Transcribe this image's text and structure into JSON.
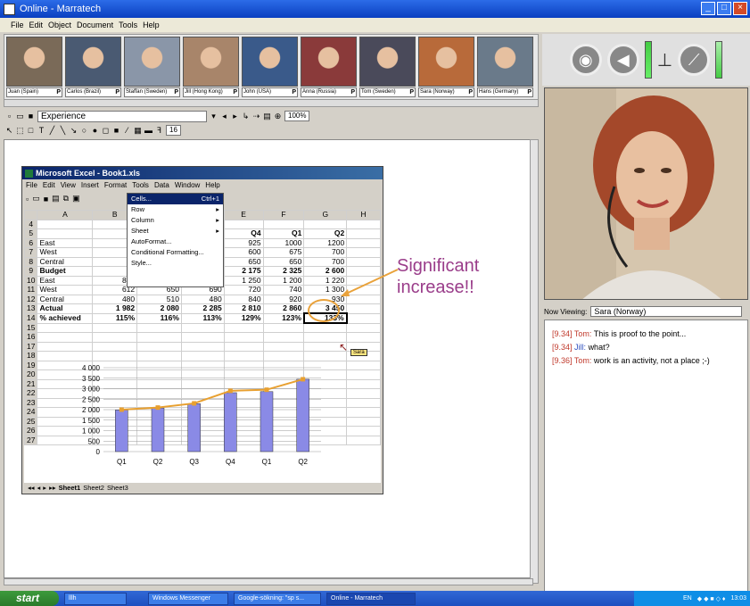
{
  "app": {
    "title": "Online - Marratech"
  },
  "menu": [
    "File",
    "Edit",
    "Object",
    "Document",
    "Tools",
    "Help"
  ],
  "participants": [
    {
      "name": "Juan (Spain)",
      "color": "#7a6a58"
    },
    {
      "name": "Carlos (Brazil)",
      "color": "#4a5a72"
    },
    {
      "name": "Staffan (Sweden)",
      "color": "#8a96a8"
    },
    {
      "name": "Jill (Hong Kong)",
      "color": "#a8856a"
    },
    {
      "name": "John (USA)",
      "color": "#3a5a8a"
    },
    {
      "name": "Anna (Russia)",
      "color": "#8a3a3a"
    },
    {
      "name": "Tom (Sweden)",
      "color": "#4a4a5a"
    },
    {
      "name": "Sara (Norway)",
      "color": "#b86a3a"
    },
    {
      "name": "Hans (Germany)",
      "color": "#6a7a8a"
    }
  ],
  "toolbar": {
    "document": "Experience",
    "zoom": "100%",
    "fontsize": "16"
  },
  "excel": {
    "title": "Microsoft Excel - Book1.xls",
    "menu": [
      "File",
      "Edit",
      "View",
      "Insert",
      "Format",
      "Tools",
      "Data",
      "Window",
      "Help"
    ],
    "columns": [
      "",
      "A",
      "B",
      "C",
      "D",
      "E",
      "F",
      "G",
      "H"
    ],
    "rows": [
      {
        "n": "4",
        "cells": [
          "",
          "",
          "",
          "",
          "",
          "",
          "",
          ""
        ]
      },
      {
        "n": "5",
        "cells": [
          "",
          "",
          "",
          "",
          "Q4",
          "Q1",
          "Q2",
          ""
        ],
        "bold": true
      },
      {
        "n": "6",
        "cells": [
          "East",
          "",
          "",
          "",
          "925",
          "1000",
          "1200",
          ""
        ]
      },
      {
        "n": "7",
        "cells": [
          "West",
          "",
          "",
          "",
          "600",
          "675",
          "700",
          ""
        ]
      },
      {
        "n": "8",
        "cells": [
          "Central",
          "",
          "",
          "",
          "650",
          "650",
          "700",
          ""
        ]
      },
      {
        "n": "9",
        "cells": [
          "Budget",
          "1",
          "",
          "",
          "2 175",
          "2 325",
          "2 600",
          ""
        ],
        "bold": true
      },
      {
        "n": "10",
        "cells": [
          "East",
          "890",
          "920",
          "1 115",
          "1 250",
          "1 200",
          "1 220",
          ""
        ]
      },
      {
        "n": "11",
        "cells": [
          "West",
          "612",
          "650",
          "690",
          "720",
          "740",
          "1 300",
          ""
        ]
      },
      {
        "n": "12",
        "cells": [
          "Central",
          "480",
          "510",
          "480",
          "840",
          "920",
          "930",
          ""
        ]
      },
      {
        "n": "13",
        "cells": [
          "Actual",
          "1 982",
          "2 080",
          "2 285",
          "2 810",
          "2 860",
          "3 450",
          ""
        ],
        "bold": true
      },
      {
        "n": "14",
        "cells": [
          "% achieved",
          "115%",
          "116%",
          "113%",
          "129%",
          "123%",
          "133%",
          ""
        ],
        "bold": true
      }
    ],
    "chart_rows": [
      "15",
      "16",
      "17",
      "18",
      "19",
      "20",
      "21",
      "22",
      "23",
      "24",
      "25",
      "26",
      "27"
    ],
    "context_menu": [
      {
        "label": "Cells...",
        "shortcut": "Ctrl+1",
        "selected": true
      },
      {
        "label": "Row",
        "sub": true
      },
      {
        "label": "Column",
        "sub": true
      },
      {
        "label": "Sheet",
        "sub": true
      },
      {
        "label": "AutoFormat..."
      },
      {
        "label": "Conditional Formatting..."
      },
      {
        "label": "Style..."
      }
    ],
    "sheets": [
      "Sheet1",
      "Sheet2",
      "Sheet3"
    ],
    "cursor_tag": "Sara"
  },
  "chart_data": {
    "type": "bar",
    "categories": [
      "Q1",
      "Q2",
      "Q3",
      "Q4",
      "Q1",
      "Q2"
    ],
    "series": [
      {
        "kind": "bar",
        "values": [
          1982,
          2080,
          2285,
          2810,
          2860,
          3450
        ],
        "color": "#8a8ae6"
      },
      {
        "kind": "line",
        "values": [
          2000,
          2100,
          2300,
          2900,
          2950,
          3450
        ],
        "color": "#e8a030"
      }
    ],
    "yticks": [
      "4 000",
      "3 500",
      "3 000",
      "2 500",
      "2 000",
      "1 500",
      "1 000",
      "500",
      "0"
    ],
    "ylim": [
      0,
      4000
    ]
  },
  "annotation": {
    "line1": "Significant",
    "line2": "increase!!"
  },
  "now_viewing": {
    "label": "Now Viewing:",
    "value": "Sara (Norway)"
  },
  "chat": [
    {
      "time": "[9.34]",
      "user": "Tom:",
      "text": "This is proof to the point..."
    },
    {
      "time": "[9.34]",
      "user": "Jill:",
      "text": "what?"
    },
    {
      "time": "[9.36]",
      "user": "Tom:",
      "text": "work is an activity, not a place ;-)"
    }
  ],
  "taskbar": {
    "start": "start",
    "tasks": [
      "lllh",
      "Windows Messenger",
      "Google-sökning: \"sp s...",
      "Online - Marratech"
    ],
    "lang": "EN",
    "time": "13:03"
  }
}
